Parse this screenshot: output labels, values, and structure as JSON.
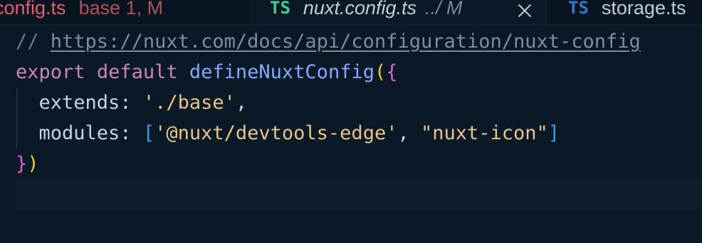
{
  "tabs": [
    {
      "name": "config.ts",
      "status": "base 1, M",
      "icon": ""
    },
    {
      "name": "nuxt.config.ts",
      "status": "../ M",
      "icon": "TS"
    },
    {
      "name": "storage.ts",
      "status": "",
      "icon": "TS"
    }
  ],
  "code": {
    "line1": {
      "comment_prefix": "// ",
      "url": "https://nuxt.com/docs/api/configuration/nuxt-config"
    },
    "line2": {
      "kw1": "export",
      "sp1": " ",
      "kw2": "default",
      "sp2": " ",
      "func": "defineNuxtConfig",
      "paren": "(",
      "brace": "{"
    },
    "line3": {
      "indent": "  ",
      "prop": "extends: ",
      "str": "'./base'",
      "punct": ","
    },
    "line4": {
      "indent": "  ",
      "prop": "modules: ",
      "open": "[",
      "str1": "'@nuxt/devtools-edge'",
      "sep": ", ",
      "str2": "\"nuxt-icon\"",
      "close": "]"
    },
    "line5": {
      "brace": "}",
      "paren": ")"
    }
  },
  "colors": {
    "background": "#0b1825",
    "keyword": "#c586c0",
    "function": "#82aaff",
    "string": "#e6c48a",
    "comment": "#6b7a88"
  }
}
